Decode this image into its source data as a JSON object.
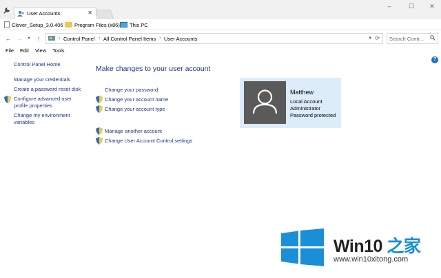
{
  "window": {
    "tab_title": "User Accounts",
    "tab_close": "✕",
    "controls": {
      "minimize": "–",
      "maximize": "☐",
      "close": "✕"
    }
  },
  "bookmarks": [
    {
      "label": "Clover_Setup_3.0.406",
      "icon": "file-icon"
    },
    {
      "label": "Program Files (x86)",
      "icon": "folder-icon"
    },
    {
      "label": "This PC",
      "icon": "pc-icon"
    }
  ],
  "address": {
    "breadcrumbs": [
      "Control Panel",
      "All Control Panel Items",
      "User Accounts"
    ],
    "separator": "›",
    "search_placeholder": "Search Contr..."
  },
  "menu": [
    "File",
    "Edit",
    "View",
    "Tools"
  ],
  "left_panel": {
    "home": "Control Panel Home",
    "links": [
      "Manage your credentials",
      "Create a password reset disk",
      "Configure advanced user profile properties",
      "Change my environment variables"
    ]
  },
  "main": {
    "title": "Make changes to your user account",
    "tasks": [
      "Change your password",
      "Change your account name",
      "Change your account type",
      "Manage another account",
      "Change User Account Control settings"
    ]
  },
  "user": {
    "name": "Matthew",
    "type": "Local Account",
    "role": "Administrator",
    "status": "Password protected"
  },
  "watermark": {
    "title_a": "Win10",
    "title_b": " 之家",
    "url": "www.win10xitong.com"
  },
  "colors": {
    "link": "#1e3287",
    "card_bg": "#dcecf9",
    "avatar_bg": "#5a5a5a",
    "watermark_blue": "#1a8fd8"
  }
}
